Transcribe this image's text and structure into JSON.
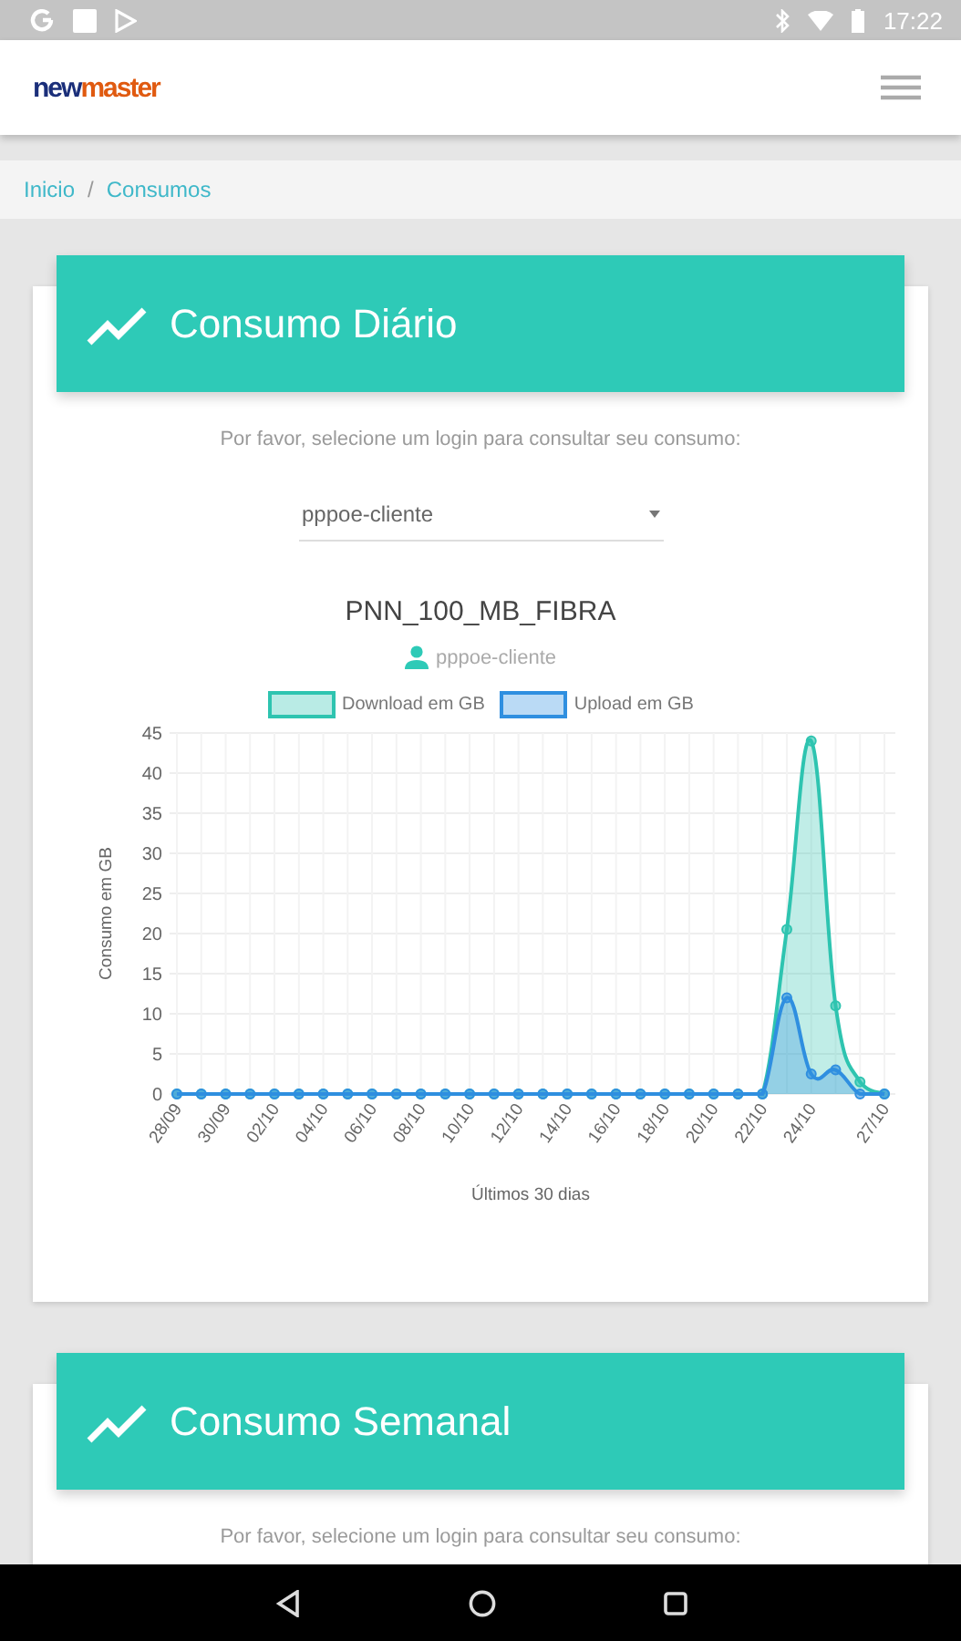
{
  "status_bar": {
    "time": "17:22"
  },
  "header": {
    "brand": [
      {
        "text": "new",
        "kind": "dark"
      },
      {
        "text": "master",
        "kind": "accent"
      }
    ]
  },
  "breadcrumb": {
    "separator": "/",
    "items": [
      "Inicio",
      "Consumos"
    ]
  },
  "cards": [
    {
      "title": "Consumo Diário",
      "prompt": "Por favor, selecione um login para consultar seu consumo:",
      "select": {
        "value": "pppoe-cliente"
      },
      "plan": "PNN_100_MB_FIBRA",
      "user": "pppoe-cliente",
      "chart_data": {
        "type": "area",
        "xlabel": "Últimos 30 dias",
        "ylabel": "Consumo em GB",
        "categories": [
          "28/09",
          null,
          "30/09",
          null,
          "02/10",
          null,
          "04/10",
          null,
          "06/10",
          null,
          "08/10",
          null,
          "10/10",
          null,
          "12/10",
          null,
          "14/10",
          null,
          "16/10",
          null,
          "18/10",
          null,
          "20/10",
          null,
          "22/10",
          null,
          "24/10",
          null,
          null,
          "27/10"
        ],
        "yticks": [
          0,
          5,
          10,
          15,
          20,
          25,
          30,
          35,
          40,
          45
        ],
        "ylim": [
          0,
          45
        ],
        "grid": true,
        "series": [
          {
            "name": "Download em GB",
            "color": "#2ec4b0",
            "values": [
              0,
              0,
              0,
              0,
              0,
              0,
              0,
              0,
              0,
              0,
              0,
              0,
              0,
              0,
              0,
              0,
              0,
              0,
              0,
              0,
              0,
              0,
              0,
              0,
              0,
              20.5,
              44,
              11,
              1.5,
              0
            ]
          },
          {
            "name": "Upload em GB",
            "color": "#2f8fe0",
            "values": [
              0,
              0,
              0,
              0,
              0,
              0,
              0,
              0,
              0,
              0,
              0,
              0,
              0,
              0,
              0,
              0,
              0,
              0,
              0,
              0,
              0,
              0,
              0,
              0,
              0,
              12,
              2.5,
              3,
              0,
              0
            ]
          }
        ]
      }
    },
    {
      "title": "Consumo Semanal",
      "prompt": "Por favor, selecione um login para consultar seu consumo:"
    }
  ]
}
